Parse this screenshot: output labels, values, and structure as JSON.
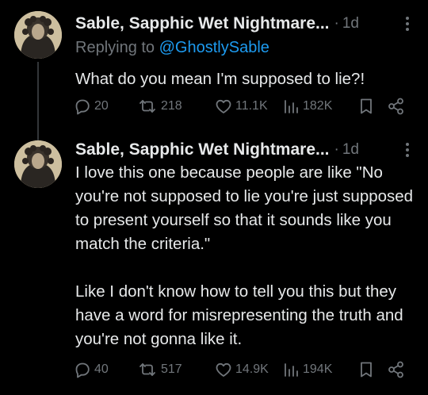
{
  "tweets": [
    {
      "author": "Sable, Sapphic Wet Nightmare...",
      "separator": "·",
      "time": "1d",
      "replying_prefix": "Replying to",
      "replying_handle": "@GhostlySable",
      "paragraphs": [
        "What do you mean I'm supposed to lie?!"
      ],
      "stats": {
        "replies": "20",
        "reposts": "218",
        "likes": "11.1K",
        "views": "182K"
      }
    },
    {
      "author": "Sable, Sapphic Wet Nightmare...",
      "separator": "·",
      "time": "1d",
      "paragraphs": [
        "I love this one because people are like \"No you're not supposed to lie you're just supposed to present yourself so that it sounds like you match the criteria.\"",
        "Like I don't know how to tell you this but they have a word for misrepresenting the truth and you're not gonna like it."
      ],
      "stats": {
        "replies": "40",
        "reposts": "517",
        "likes": "14.9K",
        "views": "194K"
      }
    }
  ],
  "icons": {
    "reply": "reply-icon",
    "repost": "repost-icon",
    "like": "heart-icon",
    "views": "views-icon",
    "bookmark": "bookmark-icon",
    "share": "share-icon",
    "more": "more-icon"
  },
  "colors": {
    "background": "#000000",
    "text": "#e7e9ea",
    "muted": "#71767b",
    "link": "#1d9bf0"
  }
}
